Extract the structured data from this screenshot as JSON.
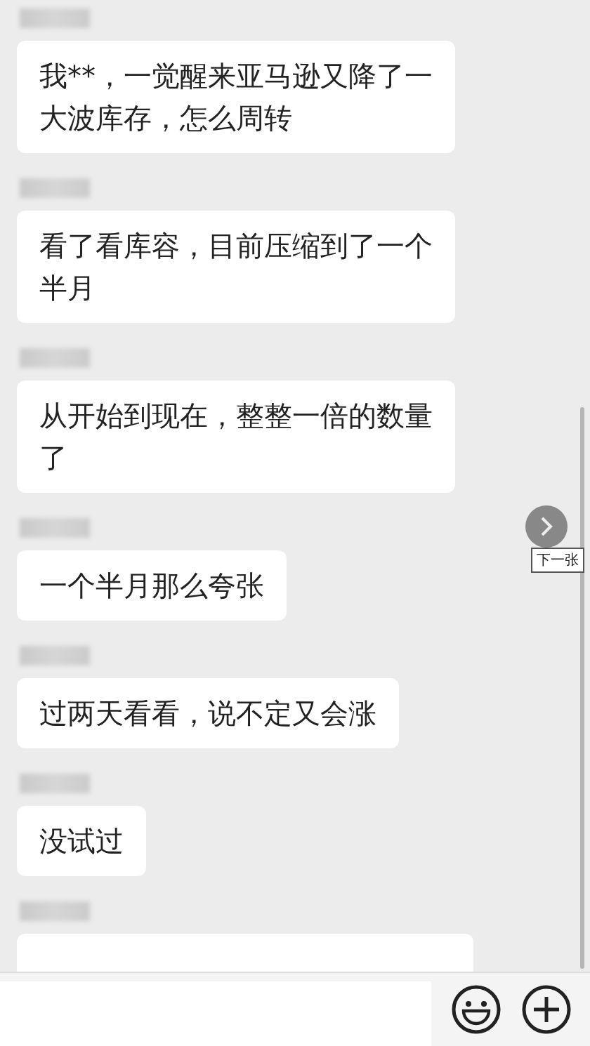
{
  "messages": [
    {
      "text": "我**，一觉醒来亚马逊又降了一大波库存，怎么周转"
    },
    {
      "text": "看了看库容，目前压缩到了一个半月"
    },
    {
      "text": "从开始到现在，整整一倍的数量了"
    },
    {
      "text": "一个半月那么夸张"
    },
    {
      "text": "过两天看看，说不定又会涨"
    },
    {
      "text": "没试过"
    }
  ],
  "more_below": true,
  "viewer": {
    "next_tooltip": "下一张"
  }
}
